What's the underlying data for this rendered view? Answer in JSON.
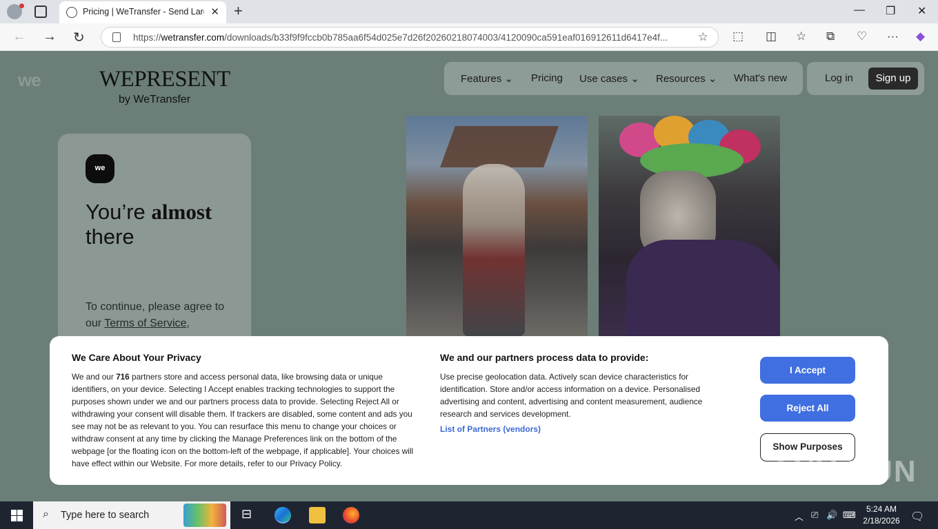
{
  "browser": {
    "tab_title": "Pricing | WeTransfer - Send Large",
    "url_prefix": "https://",
    "url_host": "wetransfer.com",
    "url_path": "/downloads/b33f9f9fccb0b785aa6f54d025e7d26f20260218074003/4120090ca591eaf016912611d6417e4f..."
  },
  "header": {
    "we_logo": "we",
    "brand": "WEPRESENT",
    "brand_sub": "by WeTransfer",
    "nav": [
      {
        "label": "Features",
        "dropdown": "⌄"
      },
      {
        "label": "Pricing"
      },
      {
        "label": "Use cases",
        "dropdown": "⌄"
      },
      {
        "label": "Resources",
        "dropdown": "⌄"
      },
      {
        "label": "What's new"
      }
    ],
    "login": "Log in",
    "signup": "Sign up"
  },
  "card": {
    "badge": "we",
    "heading_start": "You’re ",
    "heading_bold": "almost",
    "heading_end": "there",
    "lead_start": "To continue, please agree to our ",
    "terms_link": "Terms of Service",
    "lead_end": ","
  },
  "consent": {
    "col1_title": "We Care About Your Privacy",
    "col1_body_a": "We and our ",
    "col1_partner_count": "716",
    "col1_body_b": " partners store and access personal data, like browsing data or unique identifiers, on your device. Selecting I Accept enables tracking technologies to support the purposes shown under we and our partners process data to provide. Selecting Reject All or withdrawing your consent will disable them. If trackers are disabled, some content and ads you see may not be as relevant to you. You can resurface this menu to change your choices or withdraw consent at any time by clicking the Manage Preferences link on the bottom of the webpage [or the floating icon on the bottom-left of the webpage, if applicable]. Your choices will have effect within our Website. For more details, refer to our Privacy Policy.",
    "col2_title": "We and our partners process data to provide:",
    "col2_body": "Use precise geolocation data. Actively scan device characteristics for identification. Store and/or access information on a device. Personalised advertising and content, advertising and content measurement, audience research and services development.",
    "partners_link": "List of Partners (vendors)",
    "accept": "I Accept",
    "reject": "Reject All",
    "purposes": "Show Purposes"
  },
  "watermark": "ANY RUN",
  "taskbar": {
    "search_placeholder": "Type here to search",
    "time": "5:24 AM",
    "date": "2/18/2026"
  },
  "colors": {
    "page_bg": "#6b7f78",
    "accent_button": "#3f6fe0",
    "link": "#3c68d6"
  }
}
